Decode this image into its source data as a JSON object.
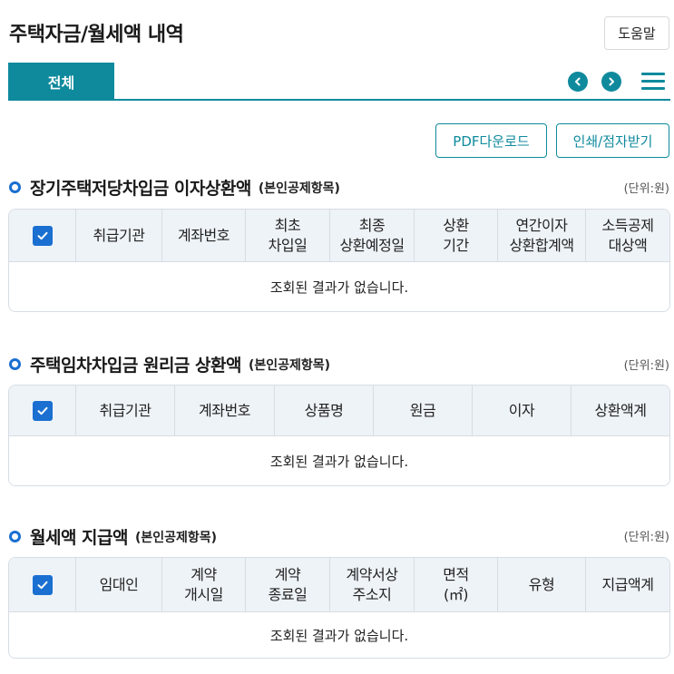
{
  "header": {
    "title": "주택자금/월세액 내역",
    "help_label": "도움말"
  },
  "tabs": [
    {
      "label": "전체",
      "active": true
    }
  ],
  "toolbar": {
    "pdf_label": "PDF다운로드",
    "print_label": "인쇄/점자받기"
  },
  "colors": {
    "accent": "#0f8a9d",
    "blue": "#1a6fd1",
    "header_bg": "#eef3f8"
  },
  "sections": [
    {
      "title": "장기주택저당차입금 이자상환액",
      "subtitle": "(본인공제항목)",
      "unit": "(단위:원)",
      "columns": [
        "취급기관",
        "계좌번호",
        "최초\n차입일",
        "최종\n상환예정일",
        "상환\n기간",
        "연간이자\n상환합계액",
        "소득공제\n대상액"
      ],
      "empty_message": "조회된 결과가 없습니다."
    },
    {
      "title": "주택임차차입금 원리금 상환액",
      "subtitle": "(본인공제항목)",
      "unit": "(단위:원)",
      "columns": [
        "취급기관",
        "계좌번호",
        "상품명",
        "원금",
        "이자",
        "상환액계"
      ],
      "empty_message": "조회된 결과가 없습니다."
    },
    {
      "title": "월세액 지급액",
      "subtitle": "(본인공제항목)",
      "unit": "(단위:원)",
      "columns": [
        "임대인",
        "계약\n개시일",
        "계약\n종료일",
        "계약서상\n주소지",
        "면적\n(㎡)",
        "유형",
        "지급액계"
      ],
      "empty_message": "조회된 결과가 없습니다."
    }
  ]
}
